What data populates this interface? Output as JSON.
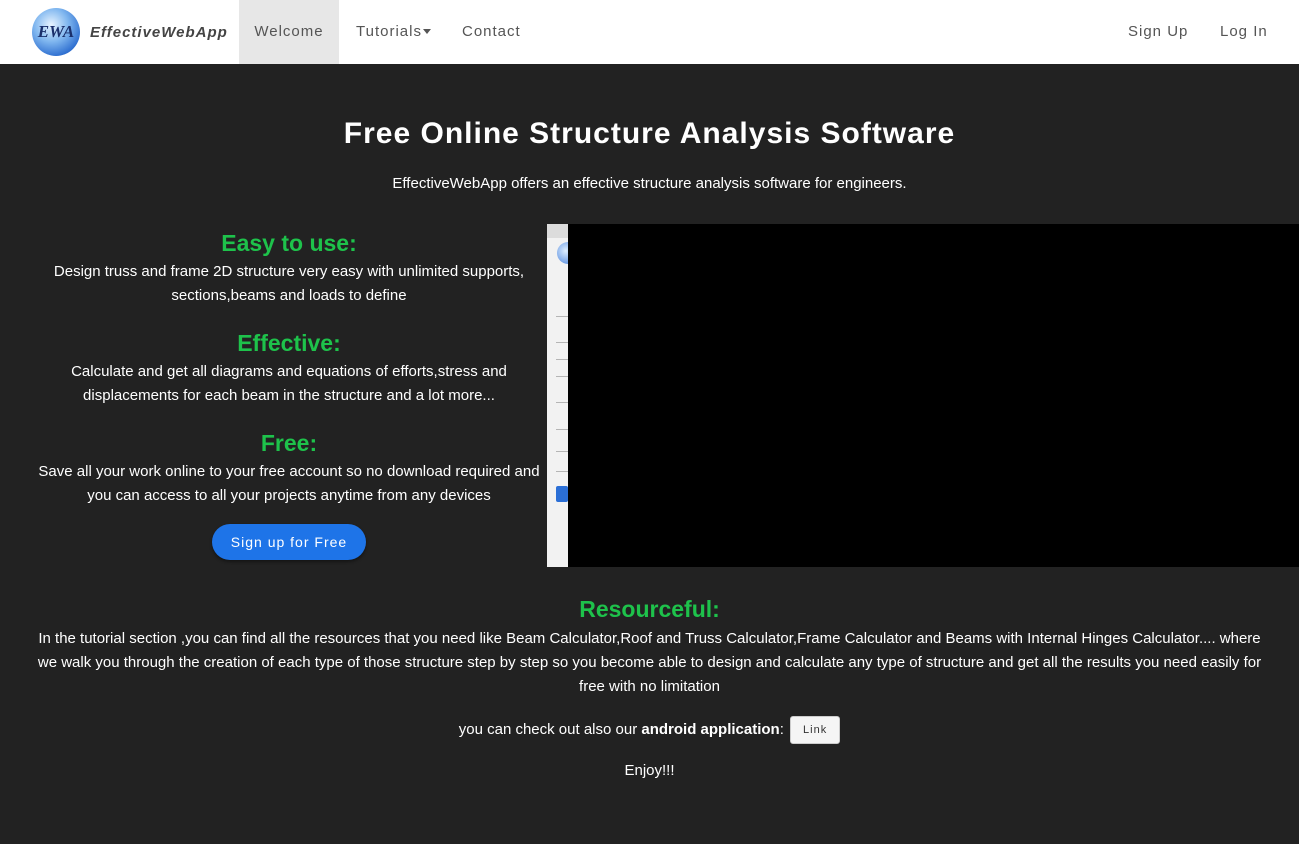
{
  "nav": {
    "logo_text": "EWA",
    "brand": "EffectiveWebApp",
    "welcome": "Welcome",
    "tutorials": "Tutorials",
    "contact": "Contact",
    "signup": "Sign Up",
    "login": "Log In"
  },
  "hero": {
    "title": "Free Online Structure Analysis Software",
    "subtitle": "EffectiveWebApp offers an effective structure analysis software for engineers."
  },
  "features": [
    {
      "title": "Easy to use:",
      "text": "Design truss and frame 2D structure very easy with unlimited supports, sections,beams and loads to define"
    },
    {
      "title": "Effective:",
      "text": "Calculate and get all diagrams and equations of efforts,stress and displacements for each beam in the structure and a lot more..."
    },
    {
      "title": "Free:",
      "text": "Save all your work online to your free account so no download required and you can access to all your projects anytime from any devices"
    }
  ],
  "cta_label": "Sign up for Free",
  "resources": {
    "title": "Resourceful:",
    "text": "In the tutorial section ,you can find all the resources that you need like Beam Calculator,Roof and Truss Calculator,Frame Calculator and Beams with Internal Hinges Calculator.... where we walk you through the creation of each type of those structure step by step so you become able to design and calculate any type of structure and get all the results you need easily for free with no limitation"
  },
  "android": {
    "prefix": "you can check out also our ",
    "bold": "android application",
    "suffix": ":",
    "link_label": "Link"
  },
  "enjoy": "Enjoy!!!",
  "colors": {
    "background": "#222222",
    "accent_green": "#1ec24b",
    "button_blue": "#1e74e8",
    "navbar": "#ffffff"
  }
}
